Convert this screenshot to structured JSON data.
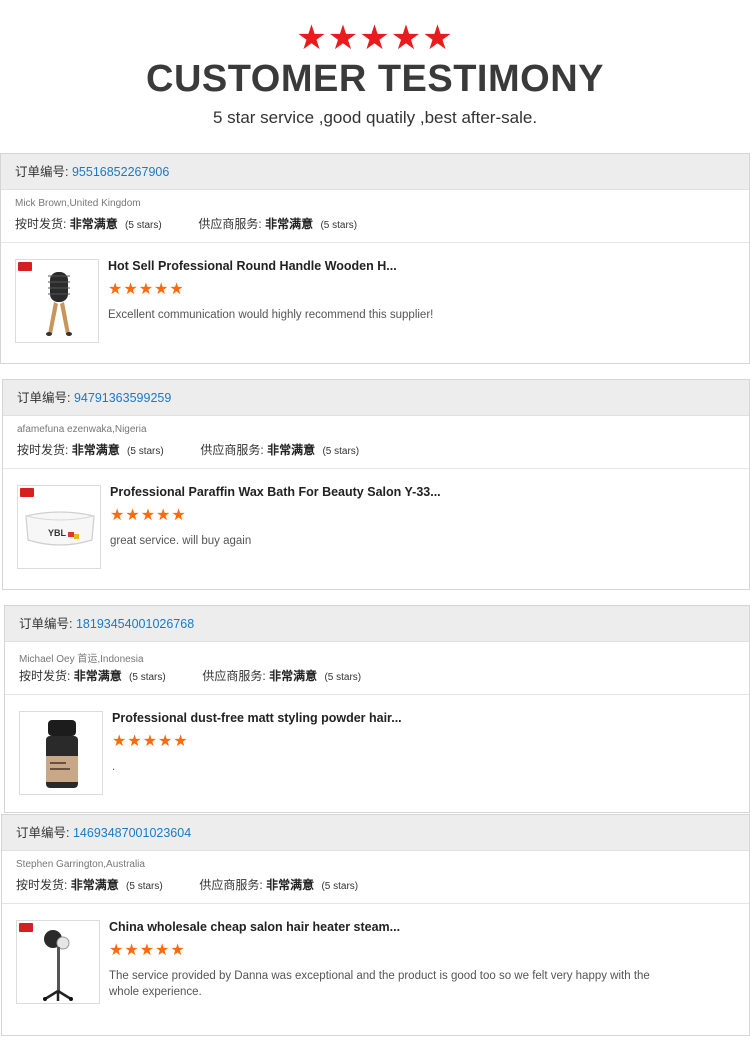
{
  "header": {
    "stars": "★★★★★",
    "title": "CUSTOMER TESTIMONY",
    "subtitle": "5 star service ,good quatily ,best after-sale."
  },
  "colors": {
    "star_red": "#e81c1c",
    "star_orange": "#ff6a0c",
    "link_blue": "#1a7ac4",
    "head_bg": "#ededed"
  },
  "labels": {
    "order_no": "订单编号:",
    "on_time": "按时发货:",
    "supplier_service": "供应商服务:",
    "very_satisfied": "非常满意",
    "five_stars": "(5 stars)"
  },
  "reviews": [
    {
      "order_number": "95516852267906",
      "buyer": "Mick Brown,United Kingdom",
      "product": "Hot Sell Professional Round Handle Wooden H...",
      "stars": "★★★★★",
      "comment": "Excellent communication would highly recommend this supplier!",
      "thumb_icon": "round-hair-brush-icon"
    },
    {
      "order_number": "94791363599259",
      "buyer": "afamefuna ezenwaka,Nigeria",
      "product": "Professional Paraffin Wax Bath For Beauty Salon Y-33...",
      "stars": "★★★★★",
      "comment": "great service. will buy again",
      "thumb_icon": "paraffin-wax-bath-icon"
    },
    {
      "order_number": "18193454001026768",
      "buyer": "Michael Oey 首运,Indonesia",
      "product": "Professional dust-free matt styling powder hair...",
      "stars": "★★★★★",
      "comment": ".",
      "thumb_icon": "styling-powder-bottle-icon"
    },
    {
      "order_number": "14693487001023604",
      "buyer": "Stephen Garrington,Australia",
      "product": "China wholesale cheap salon hair heater steam...",
      "stars": "★★★★★",
      "comment": "The service provided by Danna was exceptional and the product is good too so we felt very happy with the whole experience.",
      "thumb_icon": "hair-steamer-stand-icon"
    }
  ]
}
